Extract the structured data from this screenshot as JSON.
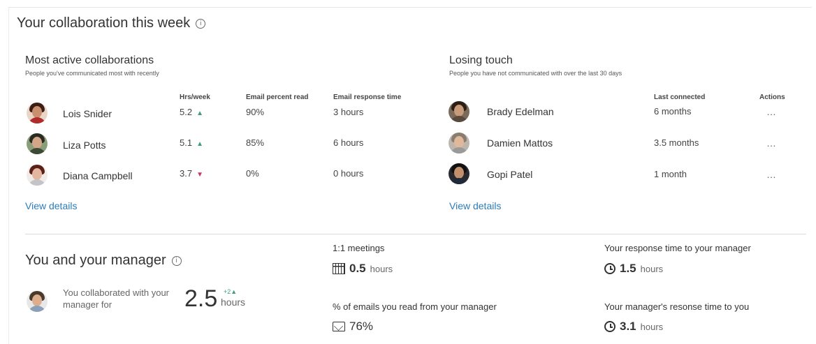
{
  "title": "Your collaboration this week",
  "active": {
    "title": "Most active collaborations",
    "subtitle": "People you've communicated most with recently",
    "columns": [
      "Hrs/week",
      "Email percent read",
      "Email response time"
    ],
    "rows": [
      {
        "name": "Lois Snider",
        "hrs": "5.2",
        "trend": "up",
        "read": "90%",
        "response": "3 hours"
      },
      {
        "name": "Liza Potts",
        "hrs": "5.1",
        "trend": "up",
        "read": "85%",
        "response": "6 hours"
      },
      {
        "name": "Diana Campbell",
        "hrs": "3.7",
        "trend": "down",
        "read": "0%",
        "response": "0 hours"
      }
    ],
    "view_details": "View details"
  },
  "losing": {
    "title": "Losing touch",
    "subtitle": "People you have not communicated with over the last 30 days",
    "columns": [
      "Last connected",
      "Actions"
    ],
    "rows": [
      {
        "name": "Brady Edelman",
        "last": "6 months",
        "action": "…"
      },
      {
        "name": "Damien Mattos",
        "last": "3.5 months",
        "action": "…"
      },
      {
        "name": "Gopi Patel",
        "last": "1 month",
        "action": "…"
      }
    ],
    "view_details": "View details"
  },
  "manager": {
    "title": "You and your manager",
    "collab_text": "You collaborated with your manager for",
    "collab_value": "2.5",
    "collab_unit": "hours",
    "collab_delta": "+2",
    "meetings_label": "1:1 meetings",
    "meetings_value": "0.5",
    "meetings_unit": "hours",
    "emails_label": "% of emails you read from your manager",
    "emails_value": "76%",
    "your_response_label": "Your response time to your manager",
    "your_response_value": "1.5",
    "your_response_unit": "hours",
    "mgr_response_label": "Your manager's resonse time to you",
    "mgr_response_value": "3.1",
    "mgr_response_unit": "hours"
  },
  "colors": {
    "link": "#2d7cb8",
    "up": "#3e9e7e",
    "down": "#c8356a"
  },
  "icons": {
    "trend_up": "▲",
    "trend_down": "▼",
    "info": "i"
  }
}
